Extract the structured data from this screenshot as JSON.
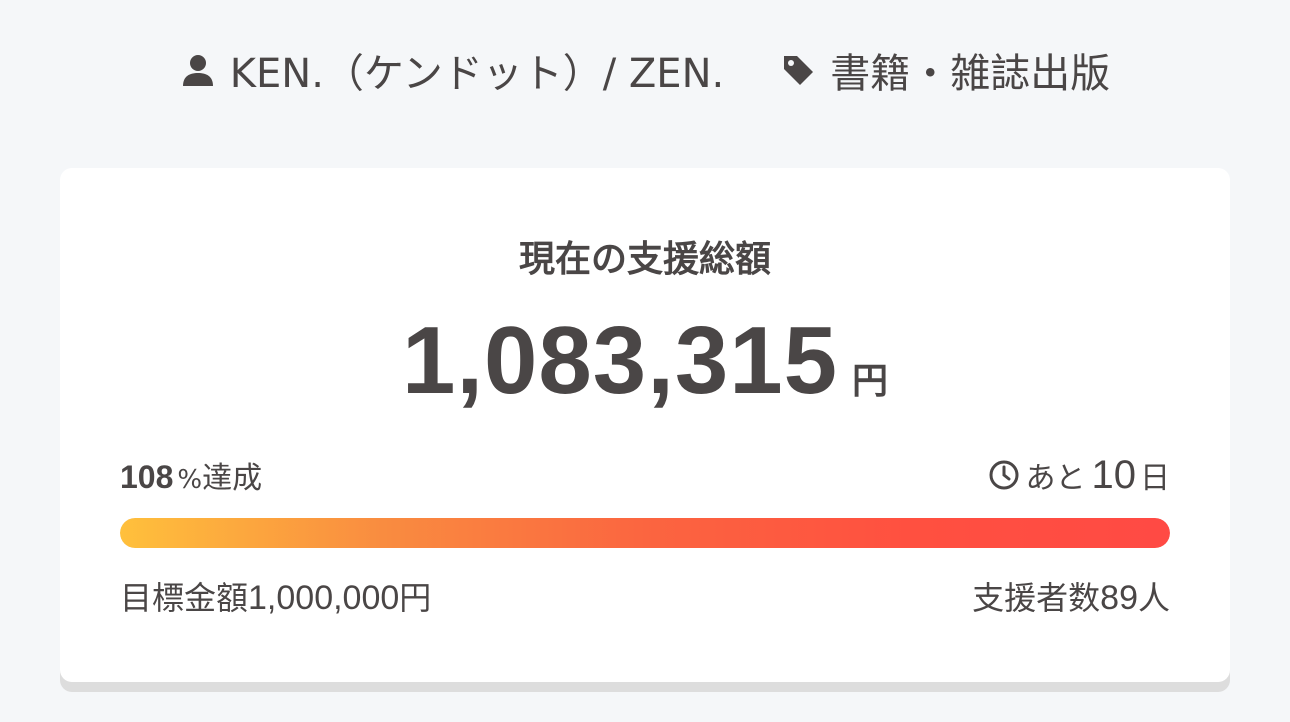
{
  "meta": {
    "author": "KEN.（ケンドット）/ ZEN.",
    "category": "書籍・雑誌出版",
    "author_icon": "user-icon",
    "category_icon": "tag-icon"
  },
  "summary": {
    "title": "現在の支援総額",
    "amount": "1,083,315",
    "amount_unit": "円"
  },
  "progress": {
    "percent_value": "108",
    "percent_sign": "%",
    "percent_suffix": "達成",
    "fill_fraction": 1.0,
    "remaining_prefix": "あと",
    "remaining_days": "10",
    "remaining_suffix": "日",
    "clock_icon": "clock-icon",
    "gradient_start": "#ffc03c",
    "gradient_end": "#ff4a44"
  },
  "stats": {
    "goal_label": "目標金額",
    "goal_value": "1,000,000",
    "goal_unit": "円",
    "backers_label": "支援者数",
    "backers_value": "89",
    "backers_unit": "人"
  }
}
